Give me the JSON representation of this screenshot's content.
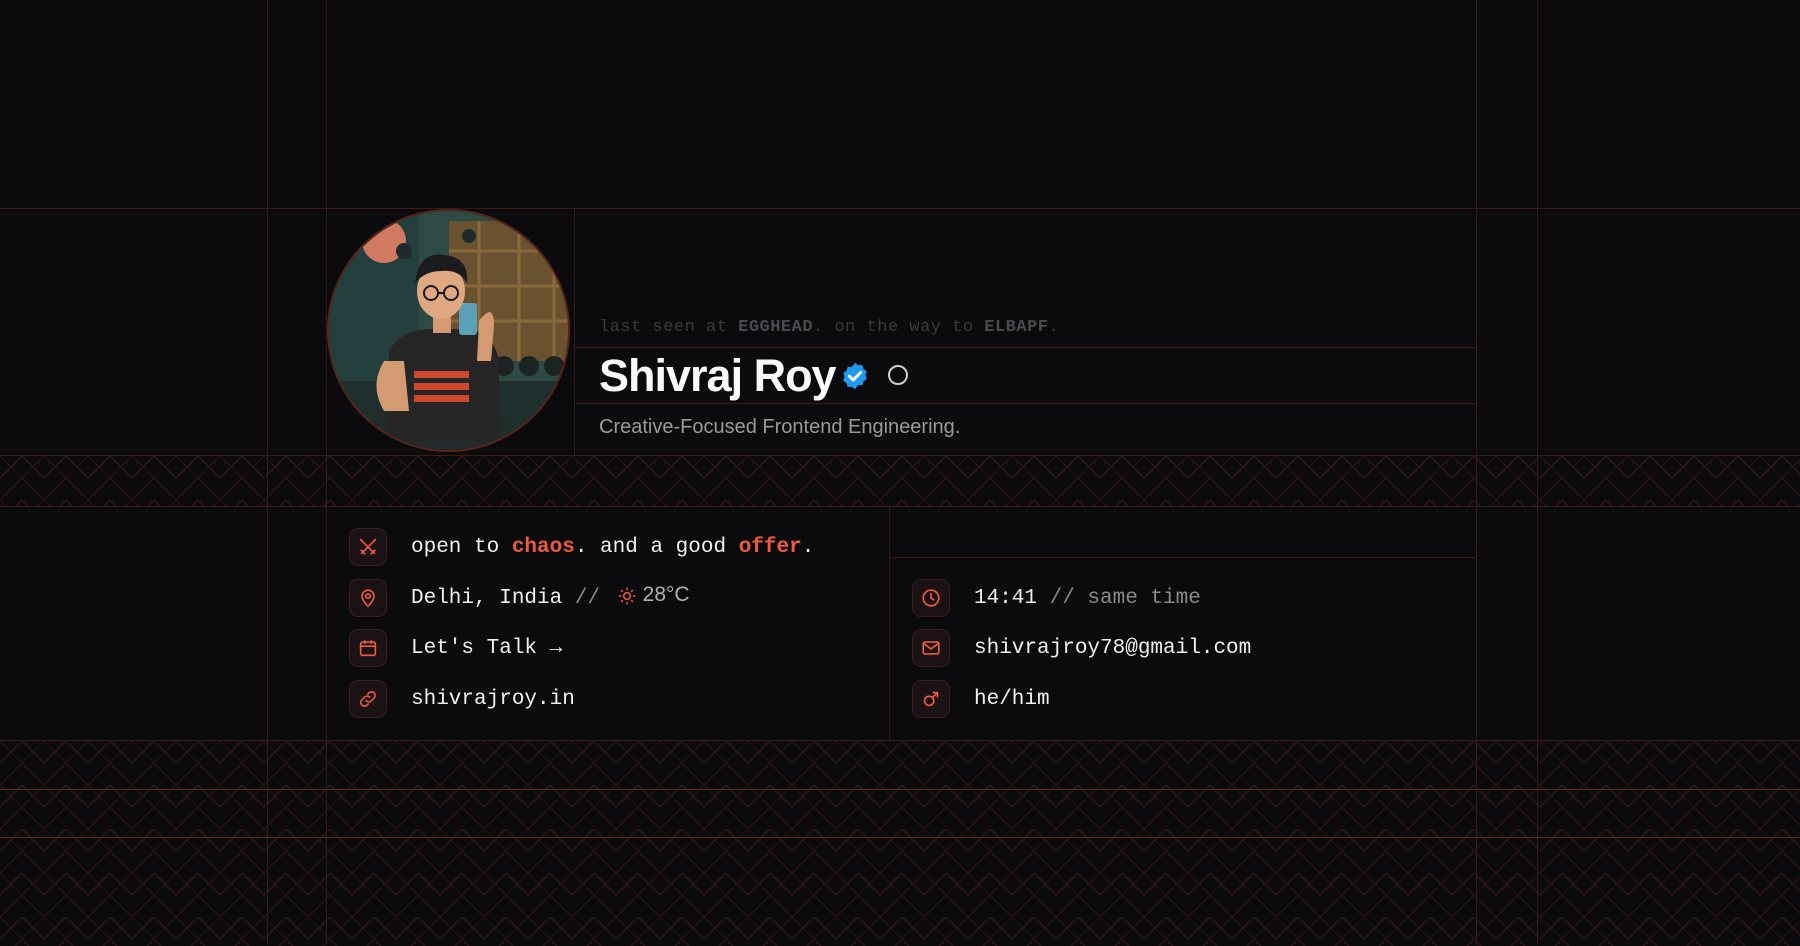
{
  "profile": {
    "status_prefix": "last seen at",
    "status_place": "EGGHEAD",
    "status_mid": ". on the way to",
    "status_dest": "ELBAPF",
    "status_suffix": ".",
    "name": "Shivraj Roy",
    "tagline": "Creative-Focused Frontend Engineering."
  },
  "info_left": {
    "motto_a": "open to",
    "motto_b": "chaos",
    "motto_c": ". and a good",
    "motto_d": "offer",
    "motto_e": ".",
    "location": "Delhi, India",
    "location_sep": "//",
    "temperature": "28°C",
    "cta": "Let's Talk →",
    "website": "shivrajroy.in"
  },
  "info_right": {
    "time": "14:41",
    "time_note": "// same time",
    "email": "shivrajroy78@gmail.com",
    "pronouns": "he/him"
  },
  "colors": {
    "accent": "#ee5a3c",
    "background": "#0b0b0d",
    "grid": "#3a1a14",
    "verified": "#1d9bf0"
  },
  "icons": {
    "motto": "crossed-swords-icon",
    "location": "map-pin-icon",
    "weather": "sun-icon",
    "calendar": "calendar-icon",
    "link": "link-icon",
    "clock": "clock-icon",
    "mail": "mail-icon",
    "pronouns": "male-symbol-icon",
    "verified": "verified-badge-icon",
    "presence": "presence-ring-icon"
  }
}
